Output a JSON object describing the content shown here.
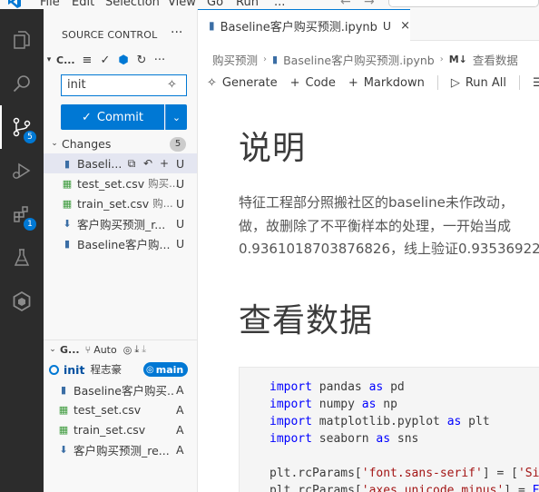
{
  "menubar": {
    "items": [
      "File",
      "Edit",
      "Selection",
      "View",
      "Go",
      "Run",
      "..."
    ]
  },
  "activity": {
    "source_control_badge": "5",
    "extensions_badge": "1"
  },
  "sidebar": {
    "title": "SOURCE CONTROL",
    "more": "···",
    "repo_label": "C...",
    "commit_message": "init",
    "commit_label": "Commit",
    "changes_label": "Changes",
    "changes_count": "5",
    "changes": [
      {
        "name": "Baseli...",
        "dir": "",
        "status": "U",
        "icon": "notebook"
      },
      {
        "name": "test_set.csv",
        "dir": "购买...",
        "status": "U",
        "icon": "csv"
      },
      {
        "name": "train_set.csv",
        "dir": "购...",
        "status": "U",
        "icon": "csv"
      },
      {
        "name": "客户购买预测_r...",
        "dir": "",
        "status": "U",
        "icon": "download"
      },
      {
        "name": "Baseline客户购...",
        "dir": "",
        "status": "U",
        "icon": "notebook"
      }
    ],
    "graph": {
      "label": "G...",
      "auto_label": "Auto",
      "commit_message": "init",
      "commit_author": "程志豪",
      "branch": "main",
      "files": [
        {
          "name": "Baseline客户购买...",
          "status": "A",
          "icon": "notebook"
        },
        {
          "name": "test_set.csv",
          "status": "A",
          "icon": "csv"
        },
        {
          "name": "train_set.csv",
          "status": "A",
          "icon": "csv"
        },
        {
          "name": "客户购买预测_re...",
          "status": "A",
          "icon": "download"
        }
      ]
    }
  },
  "editor": {
    "tab": {
      "title": "Baseline客户购买预测.ipynb",
      "status": "U",
      "close": "×"
    },
    "breadcrumb": [
      "购买预测",
      "Baseline客户购买预测.ipynb",
      "查看数据"
    ],
    "breadcrumb_md": "M↓",
    "toolbar": {
      "generate": "Generate",
      "code": "Code",
      "markdown": "Markdown",
      "run_all": "Run All"
    },
    "heading1": "说明",
    "para_lines": [
      "特征工程部分照搬社区的baseline未作改动，",
      "做，故删除了不平衡样本的处理，一开始当成",
      "0.9361018703876826，线上验证0.93536922"
    ],
    "heading2": "查看数据",
    "code_lines": [
      {
        "kw": "import",
        "rest": " pandas ",
        "kw2": "as",
        "rest2": " pd"
      },
      {
        "kw": "import",
        "rest": " numpy ",
        "kw2": "as",
        "rest2": " np"
      },
      {
        "kw": "import",
        "rest": " matplotlib.pyplot ",
        "kw2": "as",
        "rest2": " plt"
      },
      {
        "kw": "import",
        "rest": " seaborn ",
        "kw2": "as",
        "rest2": " sns"
      }
    ],
    "code_line5_a": "plt.rcParams[",
    "code_line5_s1": "'font.sans-serif'",
    "code_line5_b": "] = [",
    "code_line5_s2": "'Sim",
    "code_line6_a": "plt.rcParams[",
    "code_line6_s1": "'axes.unicode_minus'",
    "code_line6_b": "] = ",
    "code_line6_c": "Fa"
  },
  "colors": {
    "accent": "#0078d4",
    "activity_bg": "#2c2c2c",
    "sidebar_bg": "#f8f8f8"
  }
}
